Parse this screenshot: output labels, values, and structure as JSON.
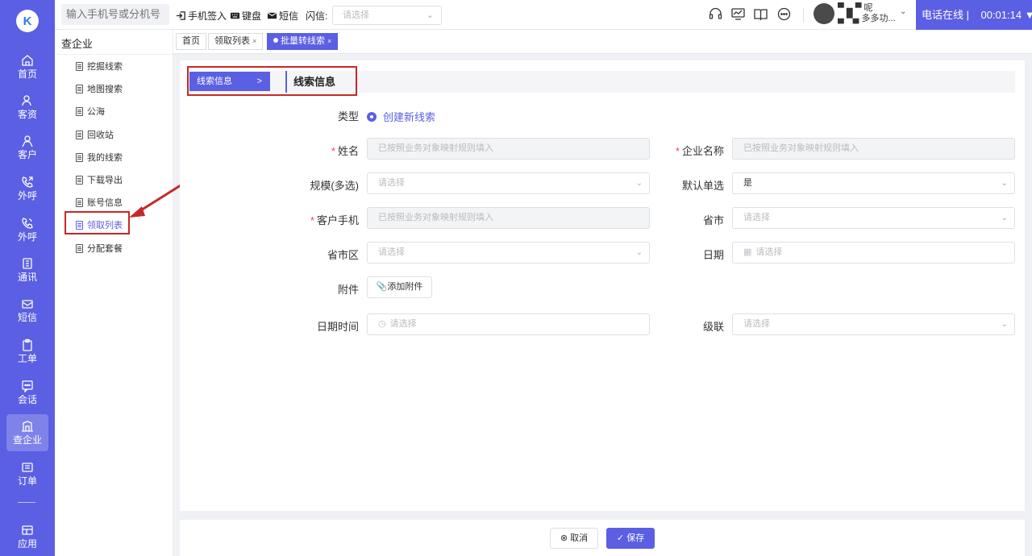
{
  "app": {
    "logo_letter": "K",
    "accent": "#5b5fe3",
    "highlight": "#c62828"
  },
  "rail": [
    {
      "label": "首页",
      "icon": "home-icon"
    },
    {
      "label": "客资",
      "icon": "users-icon"
    },
    {
      "label": "客户",
      "icon": "user-icon"
    },
    {
      "label": "外呼",
      "icon": "phone-out-icon"
    },
    {
      "label": "外呼",
      "icon": "phone-call-icon"
    },
    {
      "label": "通讯",
      "icon": "contacts-icon"
    },
    {
      "label": "短信",
      "icon": "sms-icon"
    },
    {
      "label": "工单",
      "icon": "clipboard-icon"
    },
    {
      "label": "会话",
      "icon": "chat-icon"
    },
    {
      "label": "查企业",
      "icon": "building-icon"
    },
    {
      "label": "订单",
      "icon": "order-icon"
    },
    {
      "label": "应用",
      "icon": "apps-icon"
    }
  ],
  "header": {
    "search_placeholder": "输入手机号或分机号",
    "phone_signin": "手机签入",
    "keyboard": "键盘",
    "sms": "短信",
    "flash_label": "闪信:",
    "flash_placeholder": "请选择",
    "user_line1": "▀ ▄ ▀ 呢",
    "user_line2": "▄ ▀▄ 多多功...",
    "phone_status": "电话在线",
    "timer": "00:01:14"
  },
  "submenu": {
    "title": "查企业",
    "items": [
      "挖掘线索",
      "地图搜索",
      "公海",
      "回收站",
      "我的线索",
      "下载导出",
      "账号信息",
      "领取列表",
      "分配套餐"
    ]
  },
  "tabs": [
    {
      "label": "首页"
    },
    {
      "label": "领取列表"
    },
    {
      "label": "批量转线索"
    }
  ],
  "section": {
    "tab_label": "线索信息",
    "title": "线索信息"
  },
  "form": {
    "type_label": "类型",
    "type_value": "创建新线索",
    "name_label": "姓名",
    "name_placeholder": "已按照业务对象映射规则填入",
    "company_label": "企业名称",
    "company_placeholder": "已按照业务对象映射规则填入",
    "scale_label": "规模(多选)",
    "scale_placeholder": "请选择",
    "default_label": "默认单选",
    "default_value": "是",
    "mobile_label": "客户手机",
    "mobile_placeholder": "已按照业务对象映射规则填入",
    "province_label": "省市",
    "province_placeholder": "请选择",
    "region_label": "省市区",
    "region_placeholder": "请选择",
    "date_label": "日期",
    "date_placeholder": "请选择",
    "attach_label": "附件",
    "attach_button": "添加附件",
    "datetime_label": "日期时间",
    "datetime_placeholder": "请选择",
    "cascade_label": "级联",
    "cascade_placeholder": "请选择"
  },
  "footer": {
    "cancel": "取消",
    "save": "保存"
  }
}
